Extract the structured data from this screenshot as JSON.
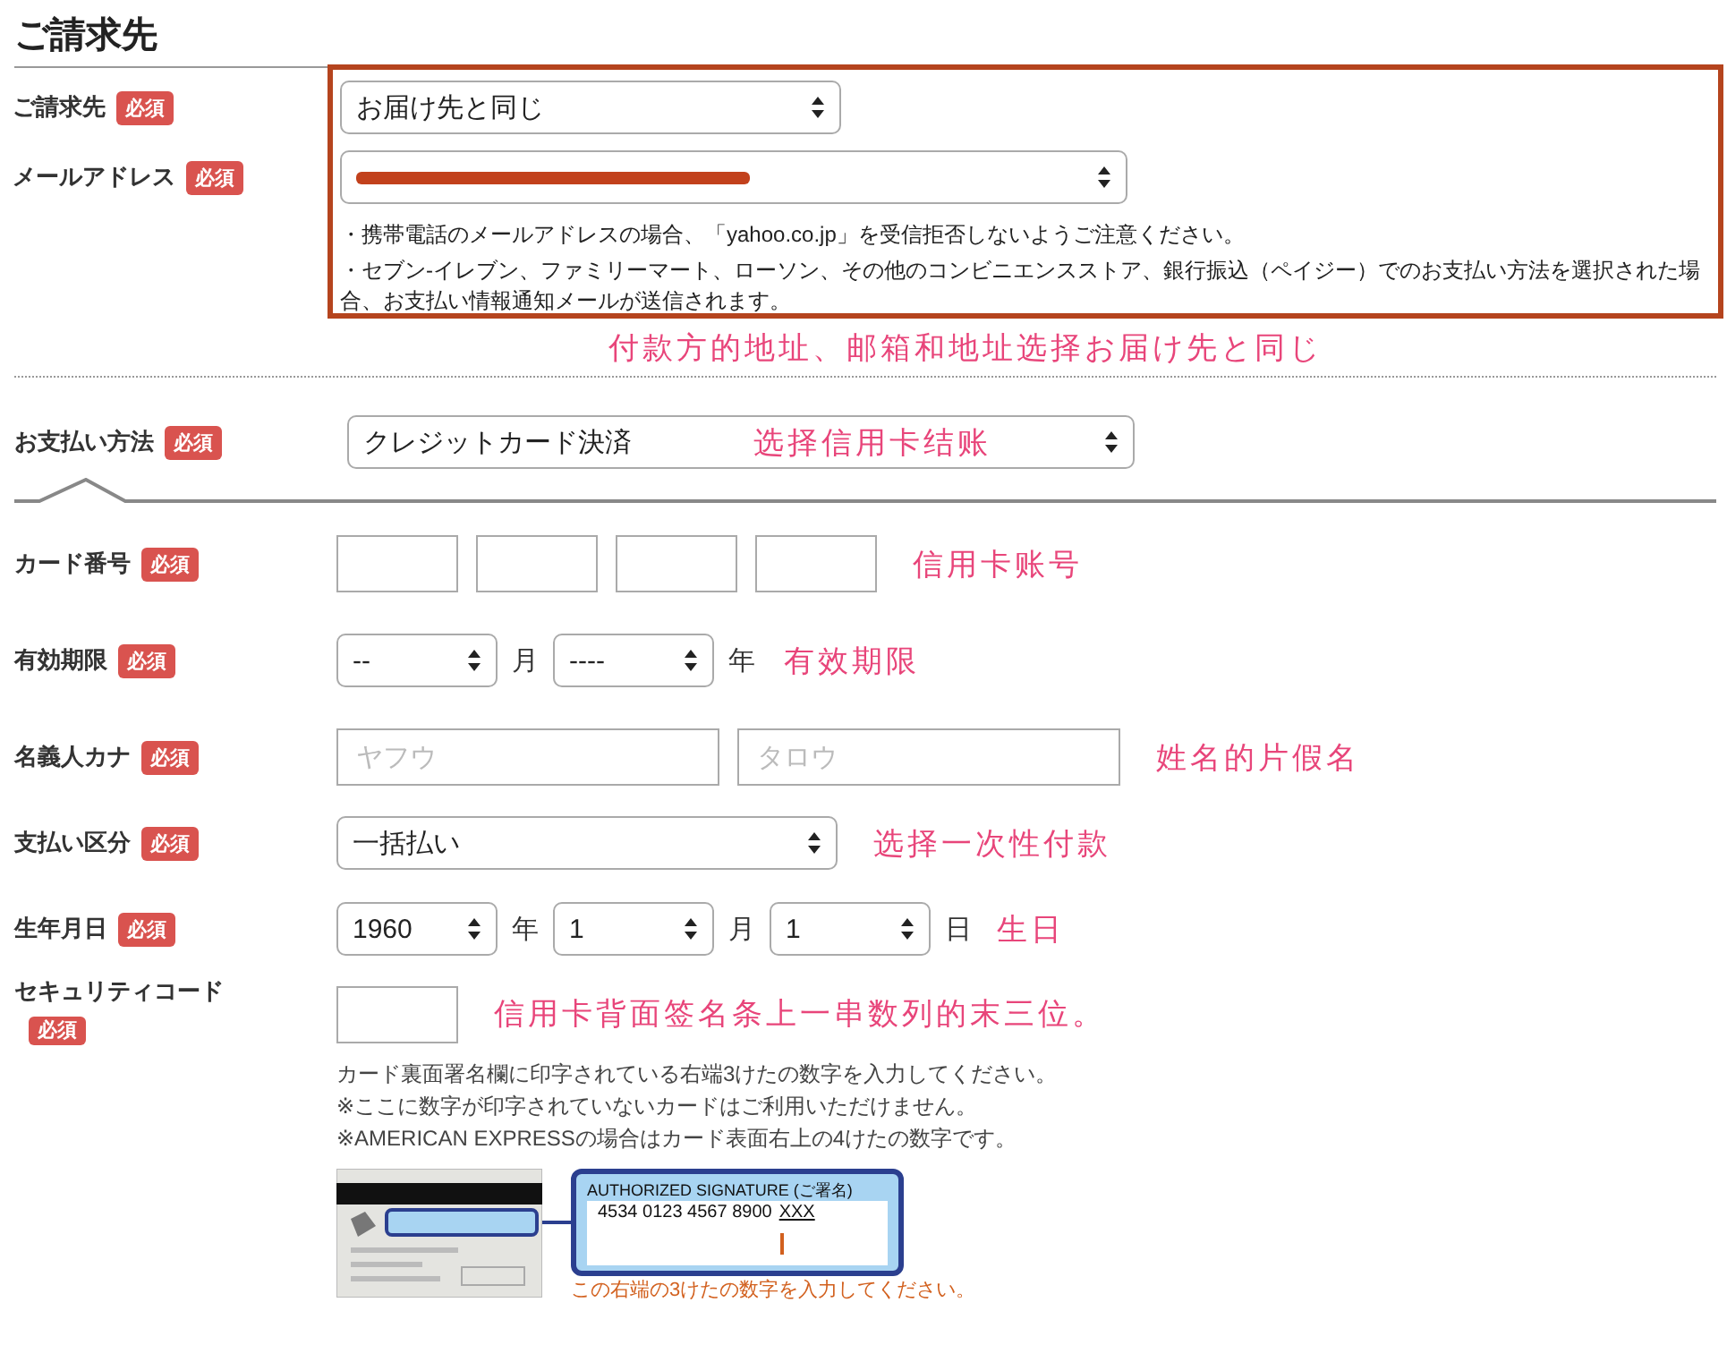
{
  "section_title": "ご請求先",
  "billing": {
    "rows": [
      {
        "label": "ご請求先",
        "badge": "必須",
        "value": "お届け先と同じ",
        "redacted": false
      },
      {
        "label": "メールアドレス",
        "badge": "必須",
        "redacted": true
      }
    ],
    "notes": [
      "・携帯電話のメールアドレスの場合、「yahoo.co.jp」を受信拒否しないようご注意ください。",
      "・セブン-イレブン、ファミリーマート、ローソン、その他のコンビニエンスストア、銀行振込（ペイジー）でのお支払い方法を選択された場合、お支払い情報通知メールが送信されます。"
    ],
    "annotation": "付款方的地址、邮箱和地址选择お届け先と同じ"
  },
  "payment_method": {
    "label": "お支払い方法",
    "badge": "必須",
    "value": "クレジットカード決済",
    "annotation": "选择信用卡结账"
  },
  "card_number": {
    "label": "カード番号",
    "badge": "必須",
    "annotation": "信用卡账号"
  },
  "expiry": {
    "label": "有効期限",
    "badge": "必須",
    "month": "--",
    "month_unit": "月",
    "year": "----",
    "year_unit": "年",
    "annotation": "有效期限"
  },
  "name_kana": {
    "label": "名義人カナ",
    "badge": "必須",
    "placeholders": [
      "ヤフウ",
      "タロウ"
    ],
    "annotation": "姓名的片假名"
  },
  "installment": {
    "label": "支払い区分",
    "badge": "必須",
    "value": "一括払い",
    "annotation": "选择一次性付款"
  },
  "birthdate": {
    "label": "生年月日",
    "badge": "必須",
    "year": "1960",
    "year_unit": "年",
    "month": "1",
    "month_unit": "月",
    "day": "1",
    "day_unit": "日",
    "annotation": "生日"
  },
  "security_code": {
    "label": "セキュリティコード",
    "badge": "必須",
    "annotation": "信用卡背面签名条上一串数列的末三位。",
    "notes": [
      "カード裏面署名欄に印字されている右端3けたの数字を入力してください。",
      "※ここに数字が印字されていないカードはご利用いただけません。",
      "※AMERICAN EXPRESSの場合はカード表面右上の4けたの数字です。"
    ],
    "signature_title": "AUTHORIZED SIGNATURE (ご署名)",
    "signature_number": "4534 0123 4567 8900",
    "signature_mark": "XXX",
    "caption": "この右端の3けたの数字を入力してください。"
  }
}
